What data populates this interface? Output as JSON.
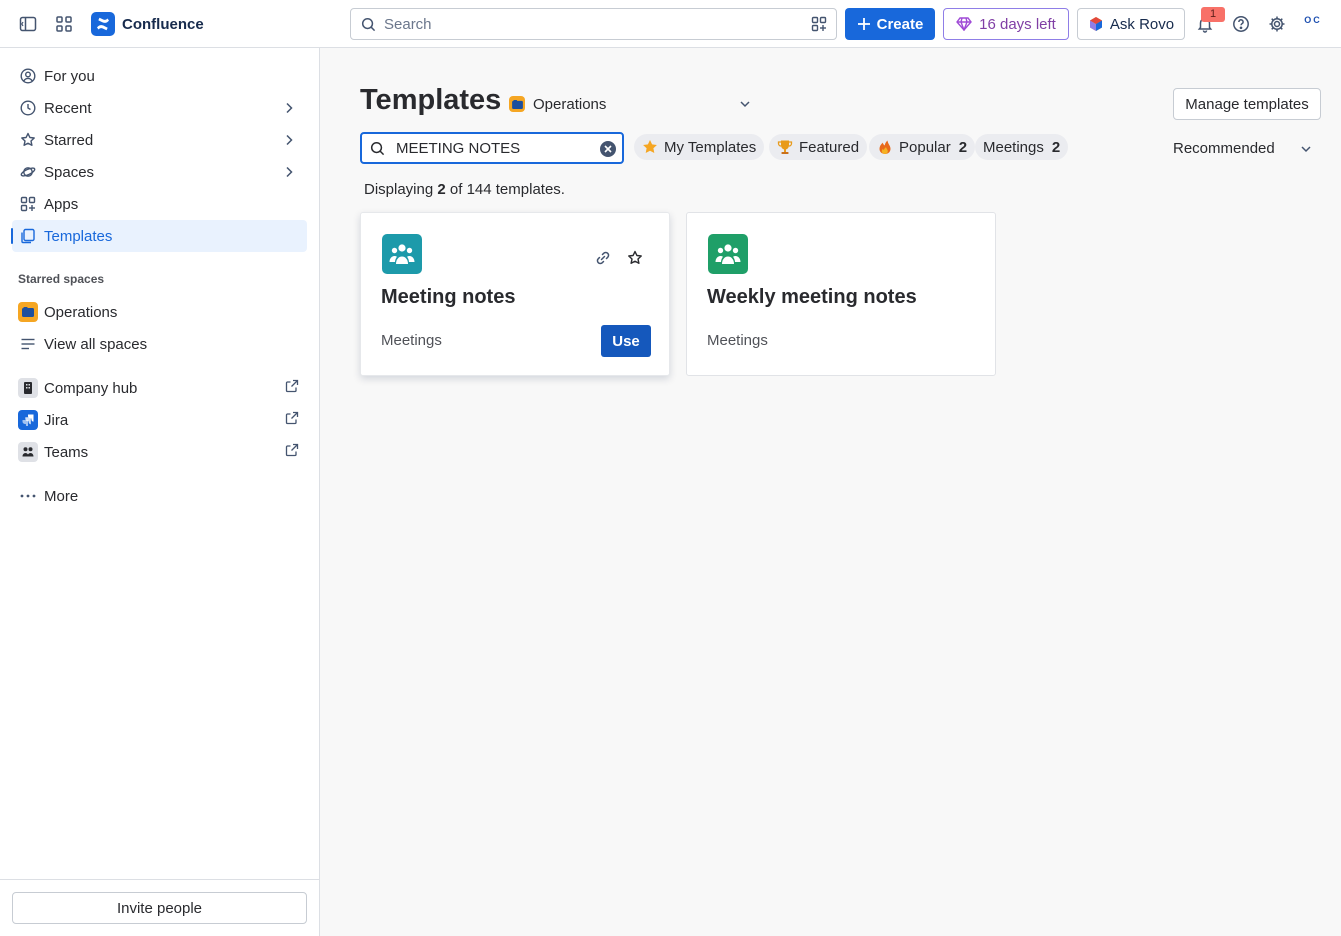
{
  "topbar": {
    "app_name": "Confluence",
    "search_placeholder": "Search",
    "create_label": "Create",
    "trial_label": "16 days left",
    "rovo_label": "Ask Rovo",
    "notification_count": "1",
    "avatar_initials": "OC",
    "brand_color": "#1868db"
  },
  "sidebar": {
    "items": [
      {
        "label": "For you",
        "icon": "user-circle-icon"
      },
      {
        "label": "Recent",
        "icon": "clock-icon"
      },
      {
        "label": "Starred",
        "icon": "star-icon"
      },
      {
        "label": "Spaces",
        "icon": "planet-icon"
      },
      {
        "label": "Apps",
        "icon": "apps-grid-icon"
      },
      {
        "label": "Templates",
        "icon": "templates-icon"
      }
    ],
    "starred_spaces_label": "Starred spaces",
    "starred_spaces": [
      {
        "label": "Operations",
        "icon": "operations-space-icon"
      },
      {
        "label": "View all spaces",
        "icon": "list-icon"
      }
    ],
    "apps": [
      {
        "label": "Company hub",
        "icon": "company-hub-icon"
      },
      {
        "label": "Jira",
        "icon": "jira-icon"
      },
      {
        "label": "Teams",
        "icon": "teams-icon"
      }
    ],
    "more_label": "More",
    "invite_label": "Invite people"
  },
  "main": {
    "title": "Templates",
    "space_selector": "Operations",
    "manage_label": "Manage templates",
    "search_value": "MEETING NOTES",
    "filters": [
      {
        "label": "My Templates",
        "count": "",
        "icon": "star-filled-icon"
      },
      {
        "label": "Featured",
        "count": "",
        "icon": "trophy-icon"
      },
      {
        "label": "Popular",
        "count": "2",
        "icon": "fire-icon"
      },
      {
        "label": "Meetings",
        "count": "2",
        "icon": ""
      }
    ],
    "sort_label": "Recommended",
    "results": {
      "prefix": "Displaying",
      "shown": "2",
      "middle": "of 144 templates."
    },
    "cards": [
      {
        "title": "Meeting notes",
        "category": "Meetings",
        "use_label": "Use",
        "icon_color": "#1d9aaa"
      },
      {
        "title": "Weekly meeting notes",
        "category": "Meetings",
        "icon_color": "#1f9f68"
      }
    ]
  }
}
